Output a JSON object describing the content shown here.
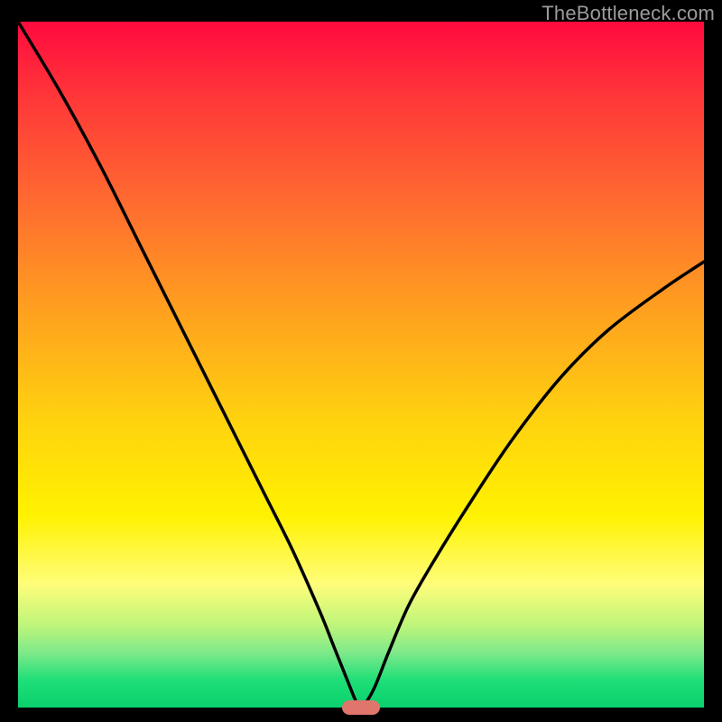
{
  "watermark": "TheBottleneck.com",
  "colors": {
    "curve": "#000000",
    "marker": "#e0756c",
    "frame": "#000000"
  },
  "chart_data": {
    "type": "line",
    "title": "",
    "xlabel": "",
    "ylabel": "",
    "xlim": [
      0,
      100
    ],
    "ylim": [
      0,
      100
    ],
    "grid": false,
    "series": [
      {
        "name": "curve",
        "x": [
          0,
          6,
          12,
          18,
          24,
          28,
          32,
          36,
          40,
          44,
          46,
          48,
          49.5,
          50.5,
          52,
          54,
          57,
          61,
          66,
          72,
          79,
          86,
          94,
          100
        ],
        "values": [
          100,
          90,
          79,
          67,
          55,
          47,
          39,
          31,
          23,
          14,
          9,
          4,
          0.5,
          0.5,
          3,
          8,
          15,
          22,
          30,
          39,
          48,
          55,
          61,
          65
        ]
      }
    ],
    "marker": {
      "x": 50,
      "y": 0
    },
    "background_gradient": {
      "direction": "vertical_top_to_bottom",
      "stops": [
        {
          "pos": 0,
          "color": "#ff0a3e"
        },
        {
          "pos": 72,
          "color": "#fff200"
        },
        {
          "pos": 100,
          "color": "#09d06d"
        }
      ]
    }
  }
}
